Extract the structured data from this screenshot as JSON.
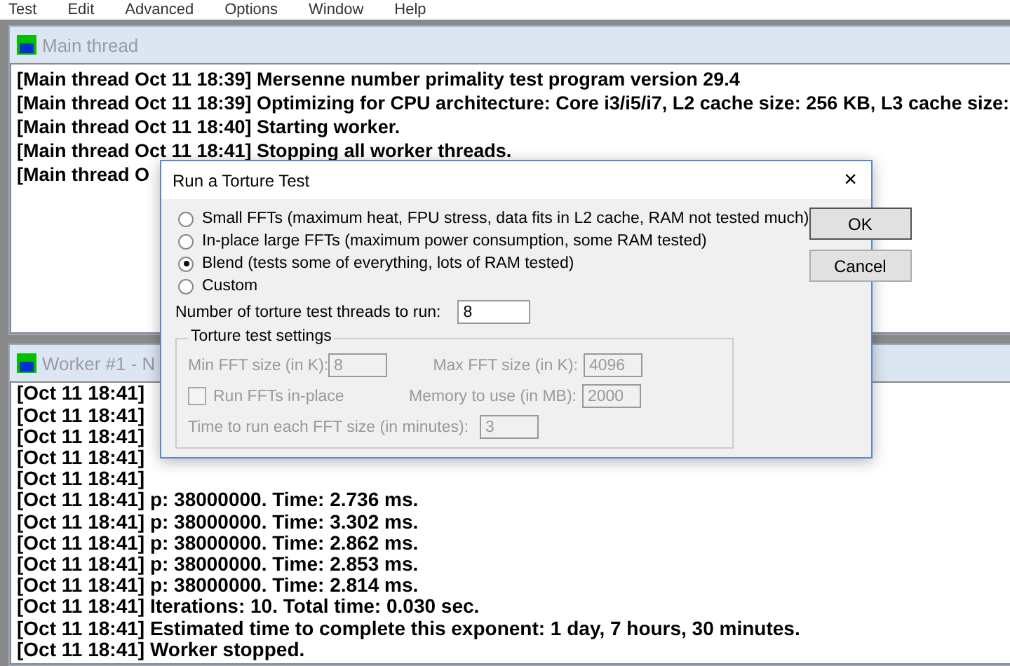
{
  "menu": [
    "Test",
    "Edit",
    "Advanced",
    "Options",
    "Window",
    "Help"
  ],
  "main_window": {
    "title": "Main thread",
    "lines": [
      "[Main thread Oct 11 18:39] Mersenne number primality test program version 29.4",
      "[Main thread Oct 11 18:39] Optimizing for CPU architecture: Core i3/i5/i7, L2 cache size: 256 KB, L3 cache size:",
      "[Main thread Oct 11 18:40] Starting worker.",
      "[Main thread Oct 11 18:41] Stopping all worker threads.",
      "[Main thread O"
    ]
  },
  "worker_window": {
    "title": "Worker #1 - N",
    "lines": [
      "[Oct 11 18:41]",
      "[Oct 11 18:41]",
      "[Oct 11 18:41]",
      "[Oct 11 18:41]",
      "[Oct 11 18:41]",
      "[Oct 11 18:41] p: 38000000.  Time: 2.736 ms.",
      "[Oct 11 18:41] p: 38000000.  Time: 3.302 ms.",
      "[Oct 11 18:41] p: 38000000.  Time: 2.862 ms.",
      "[Oct 11 18:41] p: 38000000.  Time: 2.853 ms.",
      "[Oct 11 18:41] p: 38000000.  Time: 2.814 ms.",
      "[Oct 11 18:41] Iterations: 10.  Total time: 0.030 sec.",
      "[Oct 11 18:41] Estimated time to complete this exponent: 1 day, 7 hours, 30 minutes.",
      "[Oct 11 18:41] Worker stopped."
    ]
  },
  "dialog": {
    "title": "Run a Torture Test",
    "close": "×",
    "options": [
      {
        "label": "Small FFTs (maximum heat, FPU stress, data fits in L2 cache, RAM not tested much)",
        "selected": false
      },
      {
        "label": "In-place large FFTs (maximum power consumption, some RAM tested)",
        "selected": false
      },
      {
        "label": "Blend (tests some of everything, lots of RAM tested)",
        "selected": true
      },
      {
        "label": "Custom",
        "selected": false
      }
    ],
    "threads": {
      "label": "Number of torture test threads to run:",
      "value": "8"
    },
    "buttons": [
      "OK",
      "Cancel"
    ],
    "settings": {
      "title": "Torture test settings",
      "disabled": true,
      "min_fft": {
        "label": "Min FFT size (in K):",
        "value": "8"
      },
      "max_fft": {
        "label": "Max FFT size (in K):",
        "value": "4096"
      },
      "in_place": {
        "label": "Run FFTs in-place",
        "checked": false
      },
      "memory": {
        "label": "Memory to use (in MB):",
        "value": "2000"
      },
      "time": {
        "label": "Time to run each FFT size (in minutes):",
        "value": "3"
      }
    }
  }
}
